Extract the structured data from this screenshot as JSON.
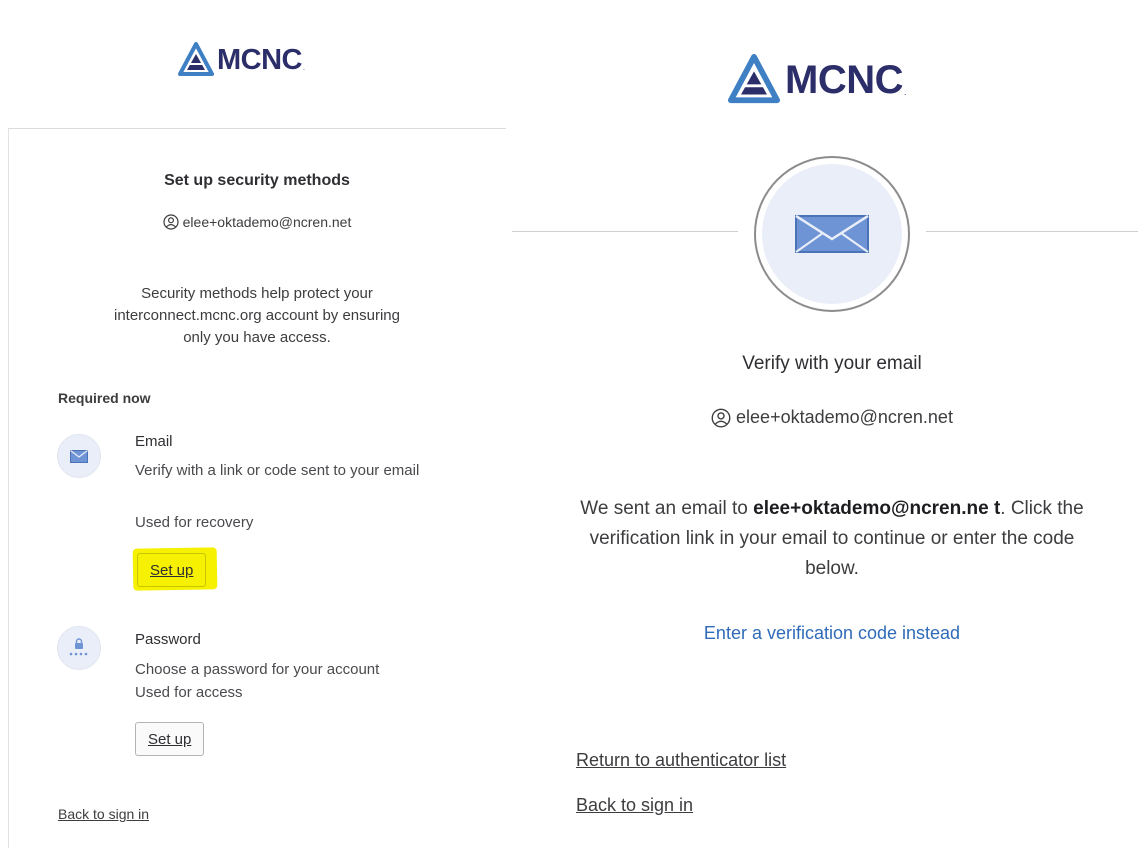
{
  "brand": {
    "name": "MCNC",
    "dot": ".",
    "logo_icon": "mcnc-triangle-logo-icon",
    "colors": {
      "navy": "#2b2e68",
      "blue": "#3f7fc4",
      "link": "#2f6bb8",
      "highlight": "#f5f100"
    }
  },
  "left": {
    "title": "Set up security methods",
    "user_icon": "user-circle-icon",
    "username": "elee+oktademo@ncren.net",
    "description": "Security methods help protect your interconnect.mcnc.org account by ensuring only you have access.",
    "required_heading": "Required now",
    "methods": [
      {
        "name": "Email",
        "icon": "envelope-icon",
        "description": "Verify with a link or code sent to your email",
        "usage": "Used for recovery",
        "button": "Set up",
        "highlighted": true
      },
      {
        "name": "Password",
        "icon": "password-lock-icon",
        "description": "Choose a password for your account",
        "usage": "Used for access",
        "button": "Set up",
        "highlighted": false
      }
    ],
    "back_link": "Back to sign in"
  },
  "right": {
    "hero_icon": "envelope-icon",
    "title": "Verify with your email",
    "user_icon": "user-circle-icon",
    "username": "elee+oktademo@ncren.net",
    "message_prefix": "We sent an email to ",
    "message_email": "elee+oktademo@ncren.ne t",
    "message_suffix": ". Click the verification link in your email to continue or enter the code below.",
    "verify_code_link": "Enter a verification code instead",
    "return_link": "Return to authenticator list",
    "back_link": "Back to sign in"
  }
}
